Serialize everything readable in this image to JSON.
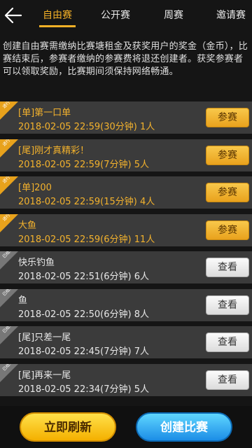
{
  "header": {
    "tabs": [
      {
        "label": "自由赛",
        "active": true
      },
      {
        "label": "公开赛",
        "active": false
      },
      {
        "label": "周赛",
        "active": false
      },
      {
        "label": "邀请赛",
        "active": false
      }
    ]
  },
  "notice": "创建自由赛需缴纳比赛塘租金及获奖用户的奖金（金币），比赛结束后，参赛者缴纳的参赛费将退还创建者。获奖参赛者可以领取奖励，比赛期间须保持网络畅通。",
  "matches": [
    {
      "title": "[单]第一口单",
      "info": "2018-02-05 22:59(30分钟) 1人",
      "badge": "进行中",
      "status": "active",
      "button": "参赛"
    },
    {
      "title": "[尾]刚才真精彩！",
      "info": "2018-02-05 22:59(7分钟) 5人",
      "badge": "进行中",
      "status": "active",
      "button": "参赛"
    },
    {
      "title": "[单]200",
      "info": "2018-02-05 22:59(15分钟) 4人",
      "badge": "进行中",
      "status": "active",
      "button": "参赛"
    },
    {
      "title": "大鱼",
      "info": "2018-02-05 22:59(6分钟) 11人",
      "badge": "进行中",
      "status": "active",
      "button": "参赛"
    },
    {
      "title": "快乐钓鱼",
      "info": "2018-02-05 22:51(6分钟) 6人",
      "badge": "已结束",
      "status": "ended",
      "button": "查看"
    },
    {
      "title": "鱼",
      "info": "2018-02-05 22:50(6分钟) 8人",
      "badge": "已结束",
      "status": "ended",
      "button": "查看"
    },
    {
      "title": "[尾]只差一尾",
      "info": "2018-02-05 22:45(7分钟) 7人",
      "badge": "已结束",
      "status": "ended",
      "button": "查看"
    },
    {
      "title": "[尾]再来一尾",
      "info": "2018-02-05 22:34(7分钟) 5人",
      "badge": "已结束",
      "status": "ended",
      "button": "查看"
    }
  ],
  "footer": {
    "refresh_label": "立即刷新",
    "create_label": "创建比赛"
  },
  "colors": {
    "accent": "#f2b027",
    "active_text": "#f3b22d",
    "create": "#1c8de6"
  },
  "icons": {
    "back": "back-arrow-icon"
  }
}
